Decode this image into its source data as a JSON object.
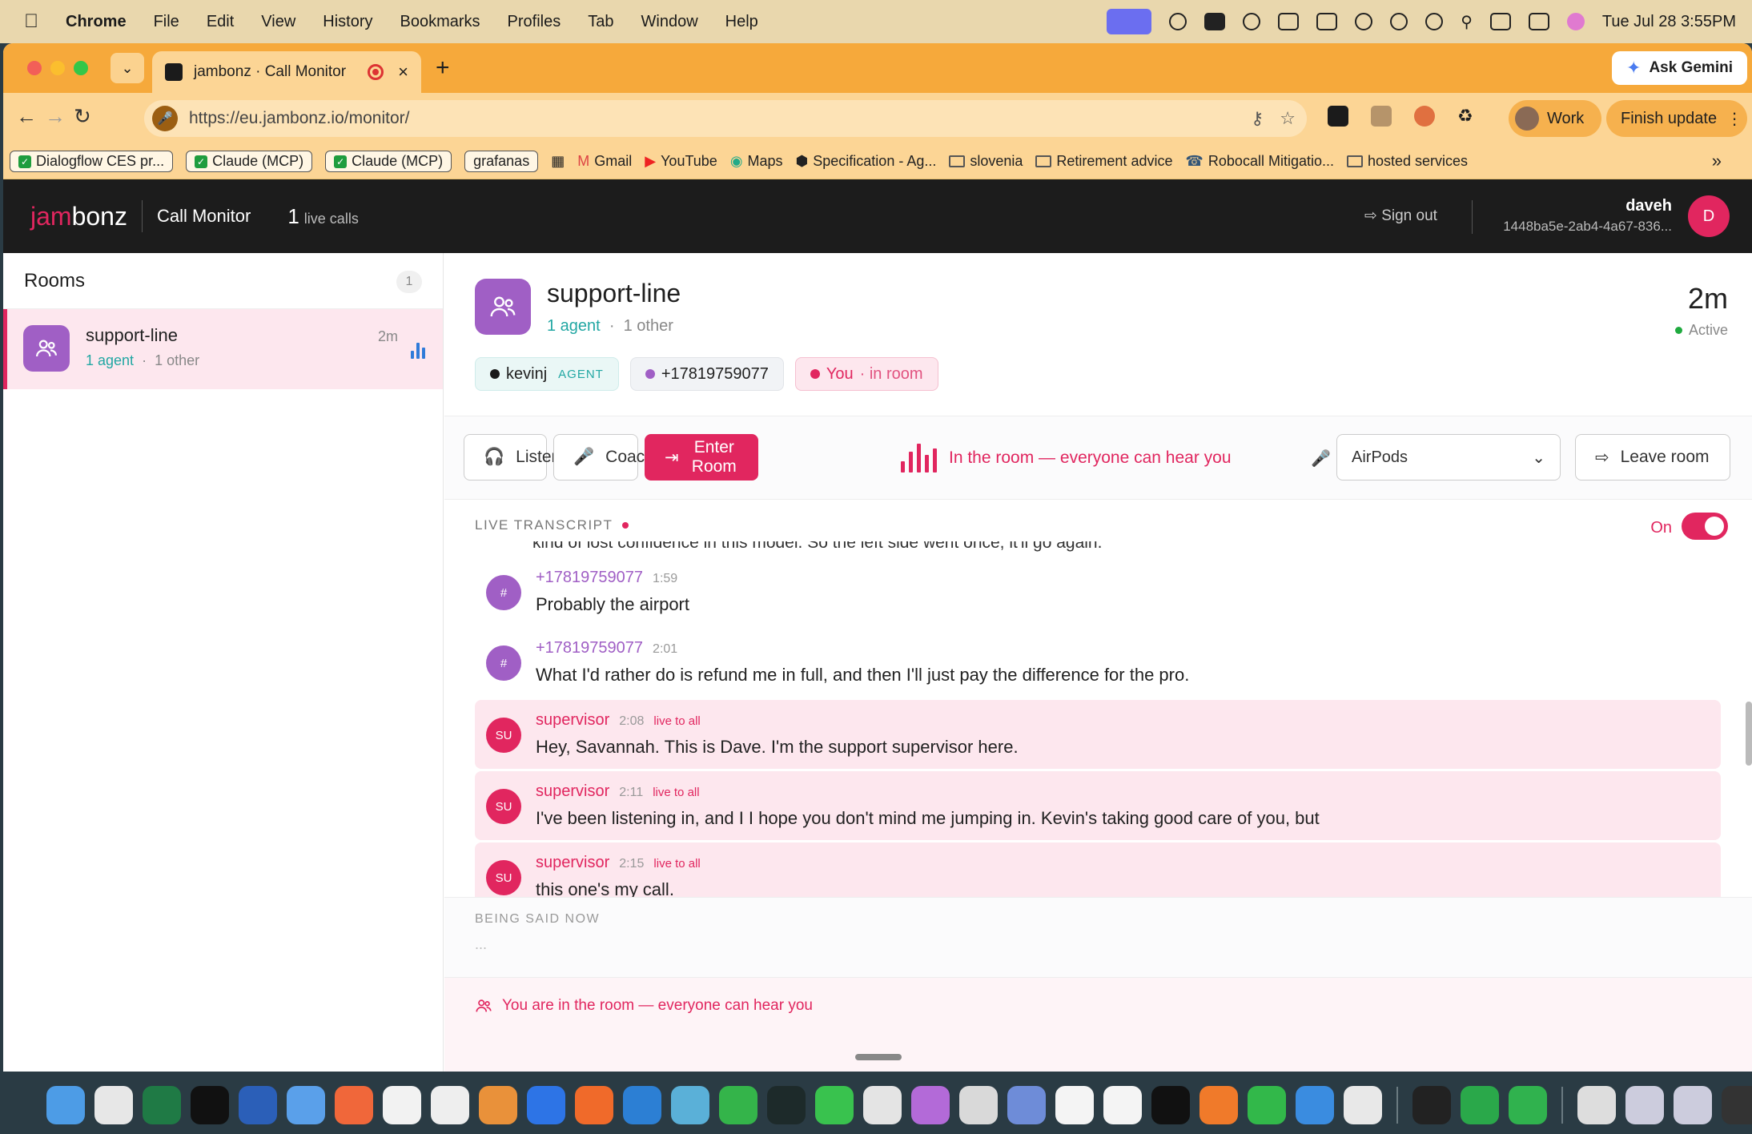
{
  "menubar": {
    "app": "Chrome",
    "items": [
      "File",
      "Edit",
      "View",
      "History",
      "Bookmarks",
      "Profiles",
      "Tab",
      "Window",
      "Help"
    ],
    "datetime": "Tue Jul 28  3:55PM"
  },
  "browser": {
    "tab_title": "jambonz · Call Monitor",
    "url": "https://eu.jambonz.io/monitor/",
    "ask_gemini": "Ask Gemini",
    "profile": "Work",
    "finish_update": "Finish update",
    "bookmarks": [
      "Dialogflow CES pr...",
      "Claude (MCP)",
      "Claude (MCP)",
      "grafanas",
      "Gmail",
      "YouTube",
      "Maps",
      "Specification - Ag...",
      "slovenia",
      "Retirement advice",
      "Robocall Mitigatio...",
      "hosted services"
    ]
  },
  "app": {
    "logo_jam": "jam",
    "logo_bonz": "bonz",
    "title": "Call Monitor",
    "live_count": "1",
    "live_label": "live calls",
    "sign_out": "Sign out",
    "user_name": "daveh",
    "user_id": "1448ba5e-2ab4-4a67-836...",
    "avatar_initial": "D"
  },
  "sidebar": {
    "title": "Rooms",
    "count": "1",
    "rooms": [
      {
        "name": "support-line",
        "agents": "1 agent",
        "others": "1 other",
        "duration": "2m"
      }
    ]
  },
  "room": {
    "name": "support-line",
    "agents": "1 agent",
    "others": "1 other",
    "duration": "2m",
    "status": "Active",
    "participants": [
      {
        "name": "kevinj",
        "tag": "AGENT",
        "color": "#1a1a1a"
      },
      {
        "name": "+17819759077",
        "color": "#a05fc5"
      },
      {
        "name": "You",
        "sub": "· in room",
        "color": "#e1265f"
      }
    ]
  },
  "controls": {
    "listen": "Listen",
    "coach": "Coach",
    "enter_room": "Enter Room",
    "status": "In the room — everyone can hear you",
    "device": "AirPods",
    "leave_room": "Leave room"
  },
  "transcript": {
    "label": "LIVE TRANSCRIPT",
    "toggle_label": "On",
    "clipped_line": "kind of lost confidence in this model. So the left side went once, it'll go again.",
    "messages": [
      {
        "avatar": "#",
        "speaker": "+17819759077",
        "time": "1:59",
        "live": "",
        "text": "Probably the airport"
      },
      {
        "avatar": "#",
        "speaker": "+17819759077",
        "time": "2:01",
        "live": "",
        "text": "What I'd rather do is refund me in full, and then I'll just pay the difference for the pro."
      },
      {
        "avatar": "SU",
        "speaker": "supervisor",
        "time": "2:08",
        "live": "live to all",
        "text": "Hey, Savannah. This is Dave. I'm the support supervisor here."
      },
      {
        "avatar": "SU",
        "speaker": "supervisor",
        "time": "2:11",
        "live": "live to all",
        "text": "I've been listening in, and I I hope you don't mind me jumping in. Kevin's taking good care of you, but"
      },
      {
        "avatar": "SU",
        "speaker": "supervisor",
        "time": "2:15",
        "live": "live to all",
        "text": "this one's my call."
      }
    ]
  },
  "being_said": {
    "label": "BEING SAID NOW",
    "text": "..."
  },
  "footer": {
    "text": "You are in the room — everyone can hear you"
  },
  "colors": {
    "brand": "#e1265f",
    "agent": "#22a7a3",
    "caller": "#a05fc5"
  }
}
